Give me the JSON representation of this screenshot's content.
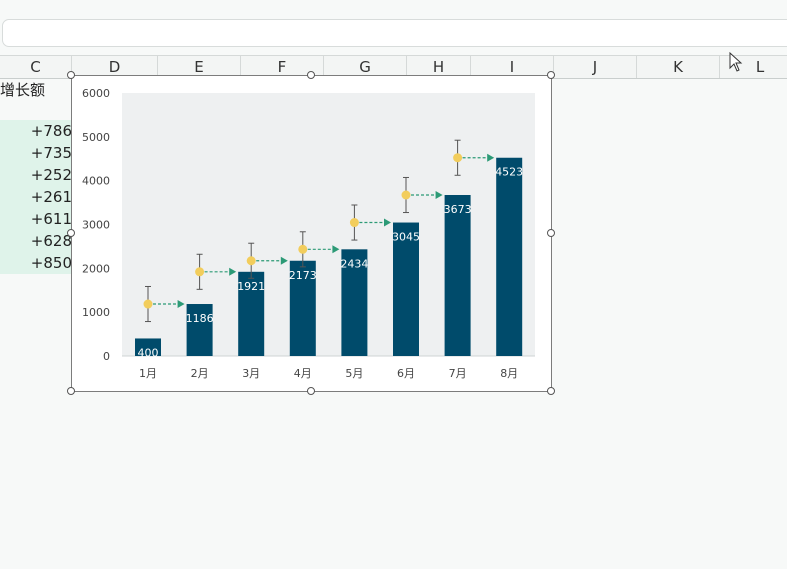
{
  "spreadsheet": {
    "columns": [
      "C",
      "D",
      "E",
      "F",
      "G",
      "H",
      "I",
      "J",
      "K",
      "L"
    ],
    "growth_header": "增长额",
    "growth_values": [
      "+786",
      "+735",
      "+252",
      "+261",
      "+611",
      "+628",
      "+850"
    ]
  },
  "chart_data": {
    "type": "bar",
    "categories": [
      "1月",
      "2月",
      "3月",
      "4月",
      "5月",
      "6月",
      "7月",
      "8月"
    ],
    "values": [
      400,
      1186,
      1921,
      2173,
      2434,
      3045,
      3673,
      4523
    ],
    "ylim": [
      0,
      6000
    ],
    "yticks": [
      "0",
      "1000",
      "2000",
      "3000",
      "4000",
      "5000",
      "6000"
    ],
    "marker_values": [
      1186,
      1921,
      2173,
      2434,
      3045,
      3673,
      4523
    ],
    "error_bar_range": 400,
    "title": "",
    "xlabel": "",
    "ylabel": "",
    "grid": false,
    "colors": {
      "bar": "#004b6b",
      "plot_background": "#eef0f1",
      "marker": "#f2cd5c",
      "arrow": "#2c9a76",
      "error_bar": "#555555",
      "data_label": "#ffffff"
    }
  }
}
